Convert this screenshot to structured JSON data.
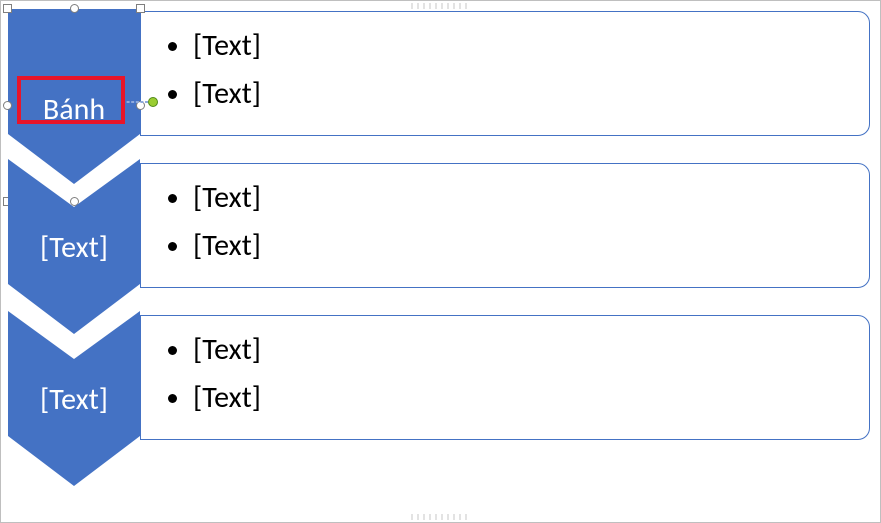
{
  "smartart": {
    "accentColor": "#4472C4",
    "selectionColor": "#8faadc",
    "highlightColor": "#e8152a",
    "items": [
      {
        "label": "Bánh",
        "selected": true,
        "highlighted": true,
        "bullets": [
          "[Text]",
          "[Text]"
        ]
      },
      {
        "label": "[Text]",
        "selected": false,
        "highlighted": false,
        "bullets": [
          "[Text]",
          "[Text]"
        ]
      },
      {
        "label": "[Text]",
        "selected": false,
        "highlighted": false,
        "bullets": [
          "[Text]",
          "[Text]"
        ]
      }
    ]
  }
}
